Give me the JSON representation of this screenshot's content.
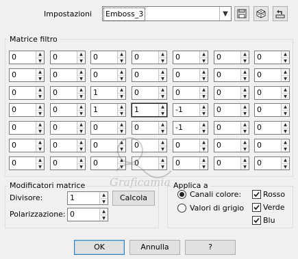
{
  "presets": {
    "label": "Impostazioni",
    "value": "Emboss_3"
  },
  "matrix": {
    "title": "Matrice filtro",
    "rows": [
      [
        "0",
        "0",
        "0",
        "0",
        "0",
        "0",
        "0"
      ],
      [
        "0",
        "0",
        "0",
        "0",
        "0",
        "0",
        "0"
      ],
      [
        "0",
        "0",
        "1",
        "0",
        "0",
        "0",
        "0"
      ],
      [
        "0",
        "0",
        "1",
        "1",
        "-1",
        "0",
        "0"
      ],
      [
        "0",
        "0",
        "0",
        "0",
        "-1",
        "0",
        "0"
      ],
      [
        "0",
        "0",
        "0",
        "0",
        "0",
        "0",
        "0"
      ],
      [
        "0",
        "0",
        "0",
        "0",
        "0",
        "0",
        "0"
      ]
    ]
  },
  "modifiers": {
    "title": "Modificatori matrice",
    "divisor_label": "Divisore:",
    "divisor_value": "1",
    "bias_label": "Polarizzazione:",
    "bias_value": "0",
    "compute_label": "Calcola"
  },
  "apply": {
    "title": "Applica a",
    "color_channels_label": "Canali colore:",
    "grey_values_label": "Valori di grigio",
    "red_label": "Rosso",
    "green_label": "Verde",
    "blue_label": "Blu"
  },
  "buttons": {
    "ok": "OK",
    "cancel": "Annulla",
    "help": "?"
  },
  "watermark": {
    "text": "Graficamia"
  },
  "icons": [
    "save-icon",
    "randomize-icon",
    "reset-icon",
    "chevron-down-icon",
    "checkmark-icon"
  ]
}
